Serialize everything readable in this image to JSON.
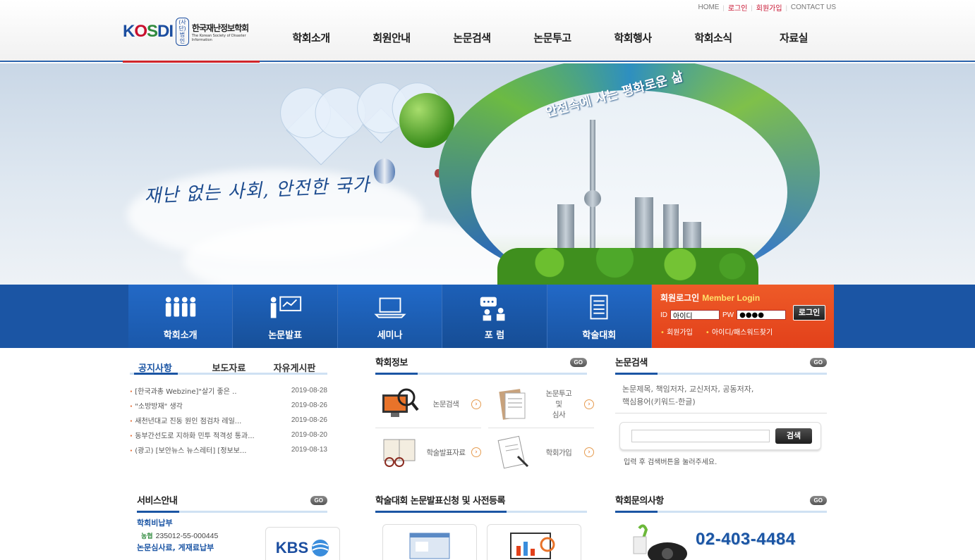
{
  "util_links": {
    "home": "HOME",
    "login": "로그인",
    "join": "회원가입",
    "contact": "CONTACT US"
  },
  "logo": {
    "mark": "KOSDI",
    "badge": "(사단)\n법인",
    "name_ko": "한국재난정보학회",
    "name_en": "The Korean Society of Disaster Information"
  },
  "nav": [
    "학회소개",
    "회원안내",
    "논문검색",
    "논문투고",
    "학회행사",
    "학회소식",
    "자료실"
  ],
  "hero": {
    "slogan": "재난 없는 사회, 안전한 국가",
    "globe_slogan": "안전속에 사는 평화로운 삶"
  },
  "quick_menu": [
    {
      "label": "학회소개",
      "icon": "people-icon"
    },
    {
      "label": "논문발표",
      "icon": "presentation-icon"
    },
    {
      "label": "세미나",
      "icon": "laptop-icon"
    },
    {
      "label": "포  럼",
      "icon": "forum-icon"
    },
    {
      "label": "학술대회",
      "icon": "document-icon"
    }
  ],
  "login": {
    "title_ko": "회원로그인",
    "title_en": "Member Login",
    "id_label": "ID",
    "id_value": "아이디",
    "pw_label": "PW",
    "pw_value": "●●●●",
    "button": "로그인",
    "join_link": "회원가입",
    "find_link": "아이디/패스워드찾기"
  },
  "notice": {
    "tabs": [
      "공지사항",
      "보도자료",
      "자유게시판"
    ],
    "items": [
      {
        "title": "[한국과총 Webzine]\"살기 좋은 ..",
        "date": "2019-08-28"
      },
      {
        "title": "\"소방방재\" 생각",
        "date": "2019-08-26"
      },
      {
        "title": "새천년대교 진동 원인 점검차 레일...",
        "date": "2019-08-26"
      },
      {
        "title": "동부간선도로 지하화 민투 적격성 통과...",
        "date": "2019-08-20"
      },
      {
        "title": "(광고) [보안뉴스 뉴스레터] [정보보...",
        "date": "2019-08-13"
      }
    ]
  },
  "society_info": {
    "title": "학회정보",
    "go": "GO",
    "items": [
      {
        "label": "논문검색",
        "icon": "monitor-search-icon"
      },
      {
        "label": "논문투고\n및\n심사",
        "icon": "paper-submit-icon"
      },
      {
        "label": "학술발표자료",
        "icon": "book-glasses-icon"
      },
      {
        "label": "학회가입",
        "icon": "form-pen-icon"
      }
    ]
  },
  "paper_search": {
    "title": "논문검색",
    "go": "GO",
    "desc": "논문제목, 책임저자, 교신저자, 공동저자,\n핵심용어(키워드-한글)",
    "button": "검색",
    "hint": "입력 후 검색버튼을 눌러주세요."
  },
  "service": {
    "title": "서비스안내",
    "go": "GO",
    "fee_title": "학회비납부",
    "bank": "농협",
    "account": "235012-55-000445",
    "review_title": "논문심사료, 게재료납부",
    "partner": "KBS"
  },
  "conference": {
    "title": "학술대회 논문발표신청 및 사전등록"
  },
  "inquiry": {
    "title": "학회문의사항",
    "go": "GO",
    "phone": "02-403-4484"
  },
  "colors": {
    "primary_blue": "#1b55a4",
    "login_orange": "#e2401a",
    "accent_red": "#c8102e"
  }
}
